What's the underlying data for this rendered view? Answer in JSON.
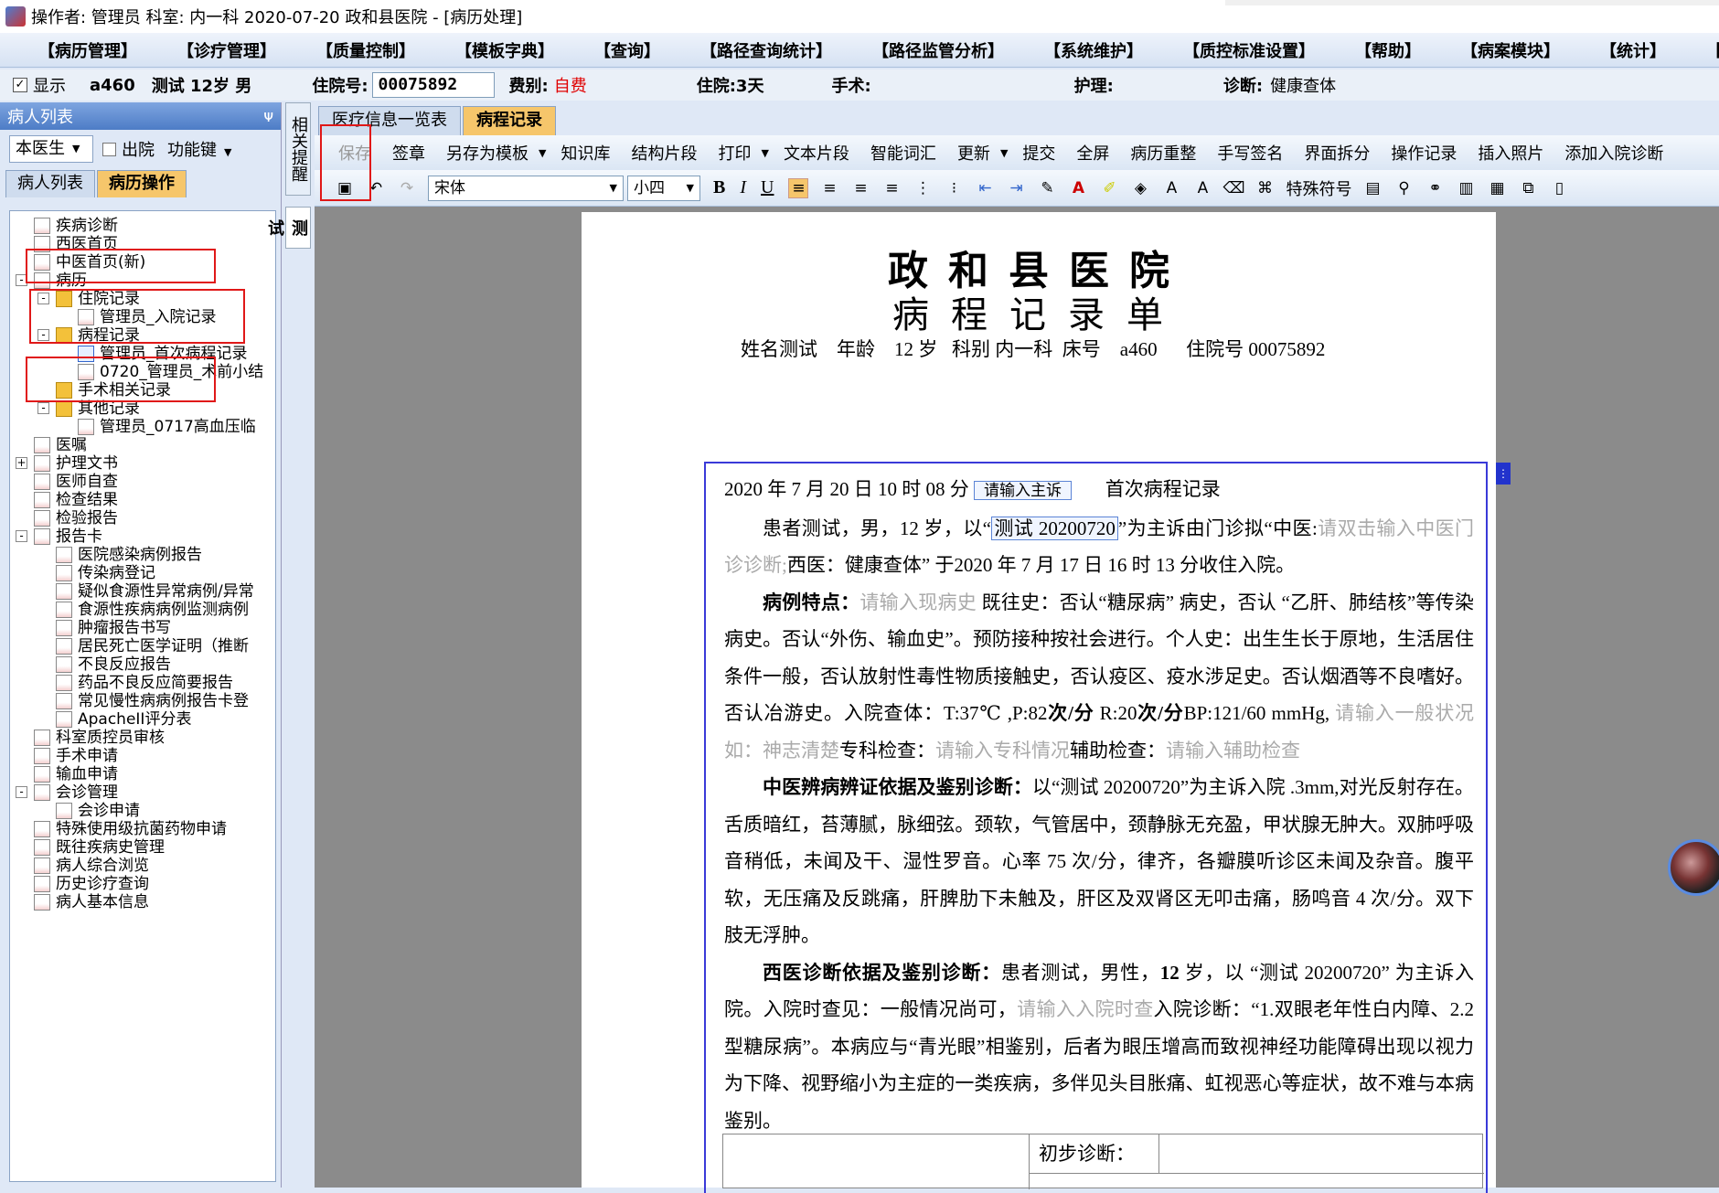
{
  "title": "操作者: 管理员  科室: 内一科  2020-07-20  政和县医院 - [病历处理]",
  "menu": [
    "【病历管理】",
    "【诊疗管理】",
    "【质量控制】",
    "【模板字典】",
    "【查询】",
    "【路径查询统计】",
    "【路径监管分析】",
    "【系统维护】",
    "【质控标准设置】",
    "【帮助】",
    "【病案模块】",
    "【统计】",
    "【窗口】"
  ],
  "info": {
    "show_label": "显示",
    "patient_id": "a460",
    "patient": "测试  12岁  男",
    "admission_label": "住院号:",
    "admission_no": "00075892",
    "fee_label": "费别:",
    "fee": "自费",
    "stay": "住院:3天",
    "surgery": "手术:",
    "nursing": "护理:",
    "diagnosis_label": "诊断:",
    "diagnosis": "健康查体"
  },
  "left": {
    "header": "病人列表",
    "pin": "ᴪ",
    "doctor_select": "本医生",
    "discharged_label": "出院",
    "function_keys": "功能键",
    "tabs": [
      "病人列表",
      "病历操作"
    ]
  },
  "tree": [
    "疾病诊断",
    "西医首页",
    "中医首页(新)",
    "病历",
    "住院记录",
    "管理员_入院记录",
    "病程记录",
    "管理员_首次病程记录",
    "0720_管理员_术前小结",
    "手术相关记录",
    "其他记录",
    "管理员_0717高血压临",
    "医嘱",
    "护理文书",
    "医师自查",
    "检查结果",
    "检验报告",
    "报告卡",
    "医院感染病例报告",
    "传染病登记",
    "疑似食源性异常病例/异常",
    "食源性疾病病例监测病例",
    "肿瘤报告书写",
    "居民死亡医学证明（推断",
    "不良反应报告",
    "药品不良反应简要报告",
    "常见慢性病病例报告卡登",
    "ApacheII评分表",
    "科室质控员审核",
    "手术申请",
    "输血申请",
    "会诊管理",
    "会诊申请",
    "特殊使用级抗菌药物申请",
    "既往疾病史管理",
    "病人综合浏览",
    "历史诊疗查询",
    "病人基本信息"
  ],
  "vtabs": [
    "相关提醒",
    "测试"
  ],
  "main_tabs": [
    "医疗信息一览表",
    "病程记录"
  ],
  "toolbar1": [
    "保存",
    "签章",
    "另存为模板",
    "知识库",
    "结构片段",
    "打印",
    "文本片段",
    "智能词汇",
    "更新",
    "提交",
    "全屏",
    "病历重整",
    "手写签名",
    "界面拆分",
    "操作记录",
    "插入照片",
    "添加入院诊断"
  ],
  "toolbar2": {
    "font": "宋体",
    "size": "小四",
    "special": "特殊符号"
  },
  "doc": {
    "hospital": "政和县医院",
    "form_title": "病程记录单",
    "name_label": "姓名测试",
    "age_label": "年龄",
    "age": "12 岁",
    "dept_label": "科别",
    "dept": "内一科",
    "bed_label": "床号",
    "bed": "a460",
    "adm_label": "住院号",
    "adm": "00075892",
    "datetime": "2020 年 7 月 20 日 10 时 08 分",
    "chief_box": "请输入主诉",
    "record_type": "首次病程记录",
    "p1a": "患者测试，男，12 岁，以“",
    "p1box": "测试  20200720",
    "p1b": "”为主诉由门诊拟“中医:",
    "p1gray": "请双击输入中医门诊诊断;",
    "p1c": "西医：健康查体” 于2020 年 7 月 17 日 16 时 13 分收住入院。",
    "p2head": "病例特点：",
    "p2gray1": "请输入现病史",
    "p2a": "既往史：否认“糖尿病” 病史，否认 “乙肝、肺结核”等传染病史。否认“外伤、输血史”。预防接种按社会进行。个人史：出生生长于原地，生活居住条件一般，否认放射性毒性物质接触史，否认疫区、疫水涉足史。否认烟酒等不良嗜好。否认冶游史。入院查体：T:37℃ ,P:82",
    "p2b1": "次/分",
    "p2b": " R:20",
    "p2b2": "次/分",
    "p2c": "BP:121/60 mmHg, ",
    "p2gray2": "请输入一般状况如：神志清楚",
    "p2d": "专科检查：",
    "p2gray3": "请输入专科情况",
    "p2e": "辅助检查：",
    "p2gray4": "请输入辅助检查",
    "p3head": "中医辨病辨证依据及鉴别诊断：",
    "p3": "以“测试 20200720”为主诉入院 .3mm,对光反射存在。舌质暗红，苔薄腻，脉细弦。颈软，气管居中，颈静脉无充盈，甲状腺无肿大。双肺呼吸音稍低，未闻及干、湿性罗音。心率 75 次/分，律齐，各瓣膜听诊区未闻及杂音。腹平软，无压痛及反跳痛，肝脾肋下未触及，肝区及双肾区无叩击痛，肠鸣音 4 次/分。双下肢无浮肿。",
    "p4head": "西医诊断依据及鉴别诊断：",
    "p4a": "患者测试，男性，",
    "p4age": "12",
    "p4b": " 岁，以 “测试 20200720” 为主诉入院。入院时查见：一般情况尚可，",
    "p4gray": "请输入入院时查",
    "p4c": "入院诊断：“1.双眼老年性白内障、2.2 型糖尿病”。本病应与“青光眼”相鉴别，后者为眼压增高而致视神经功能障碍出现以视力为下降、视野缩小为主症的一类疾病，多伴见头目胀痛、虹视恶心等症状，故不难与本病鉴别。",
    "prelim": "初步诊断："
  }
}
